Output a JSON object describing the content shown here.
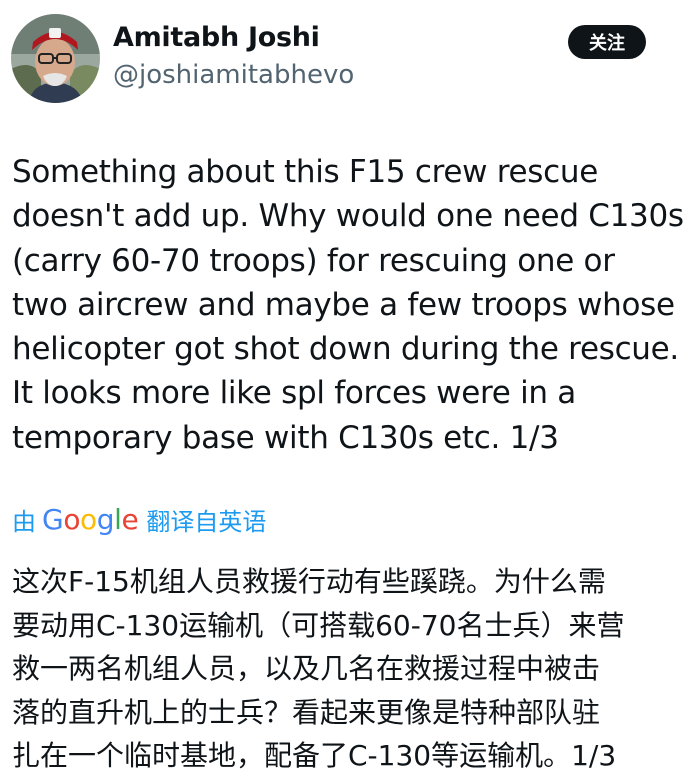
{
  "author": {
    "name": "Amitabh Joshi",
    "handle": "@joshiamitabhevo"
  },
  "follow_label": "关注",
  "tweet": {
    "lines": [
      "Something about this F15 crew rescue",
      "doesn't add up. Why would one need C130s",
      "(carry 60-70 troops) for rescuing one or",
      "two aircrew and maybe a few troops whose",
      "helicopter got shot down during the rescue.",
      "It looks more like spl forces were in a",
      "temporary base with C130s etc. 1/3"
    ]
  },
  "translation": {
    "prefix": "由",
    "google_logo": "Google",
    "suffix": "翻译自英语",
    "lines": [
      "这次F-15机组人员救援行动有些蹊跷。为什么需",
      "要动用C-130运输机（可搭载60-70名士兵）来营",
      "救一两名机组人员，以及几名在救援过程中被击",
      "落的直升机上的士兵？看起来更像是特种部队驻",
      "扎在一个临时基地，配备了C-130等运输机。1/3"
    ]
  },
  "colors": {
    "text": "#0f1419",
    "secondary": "#536471",
    "link": "#1d9bf0",
    "button_bg": "#0f1419"
  }
}
